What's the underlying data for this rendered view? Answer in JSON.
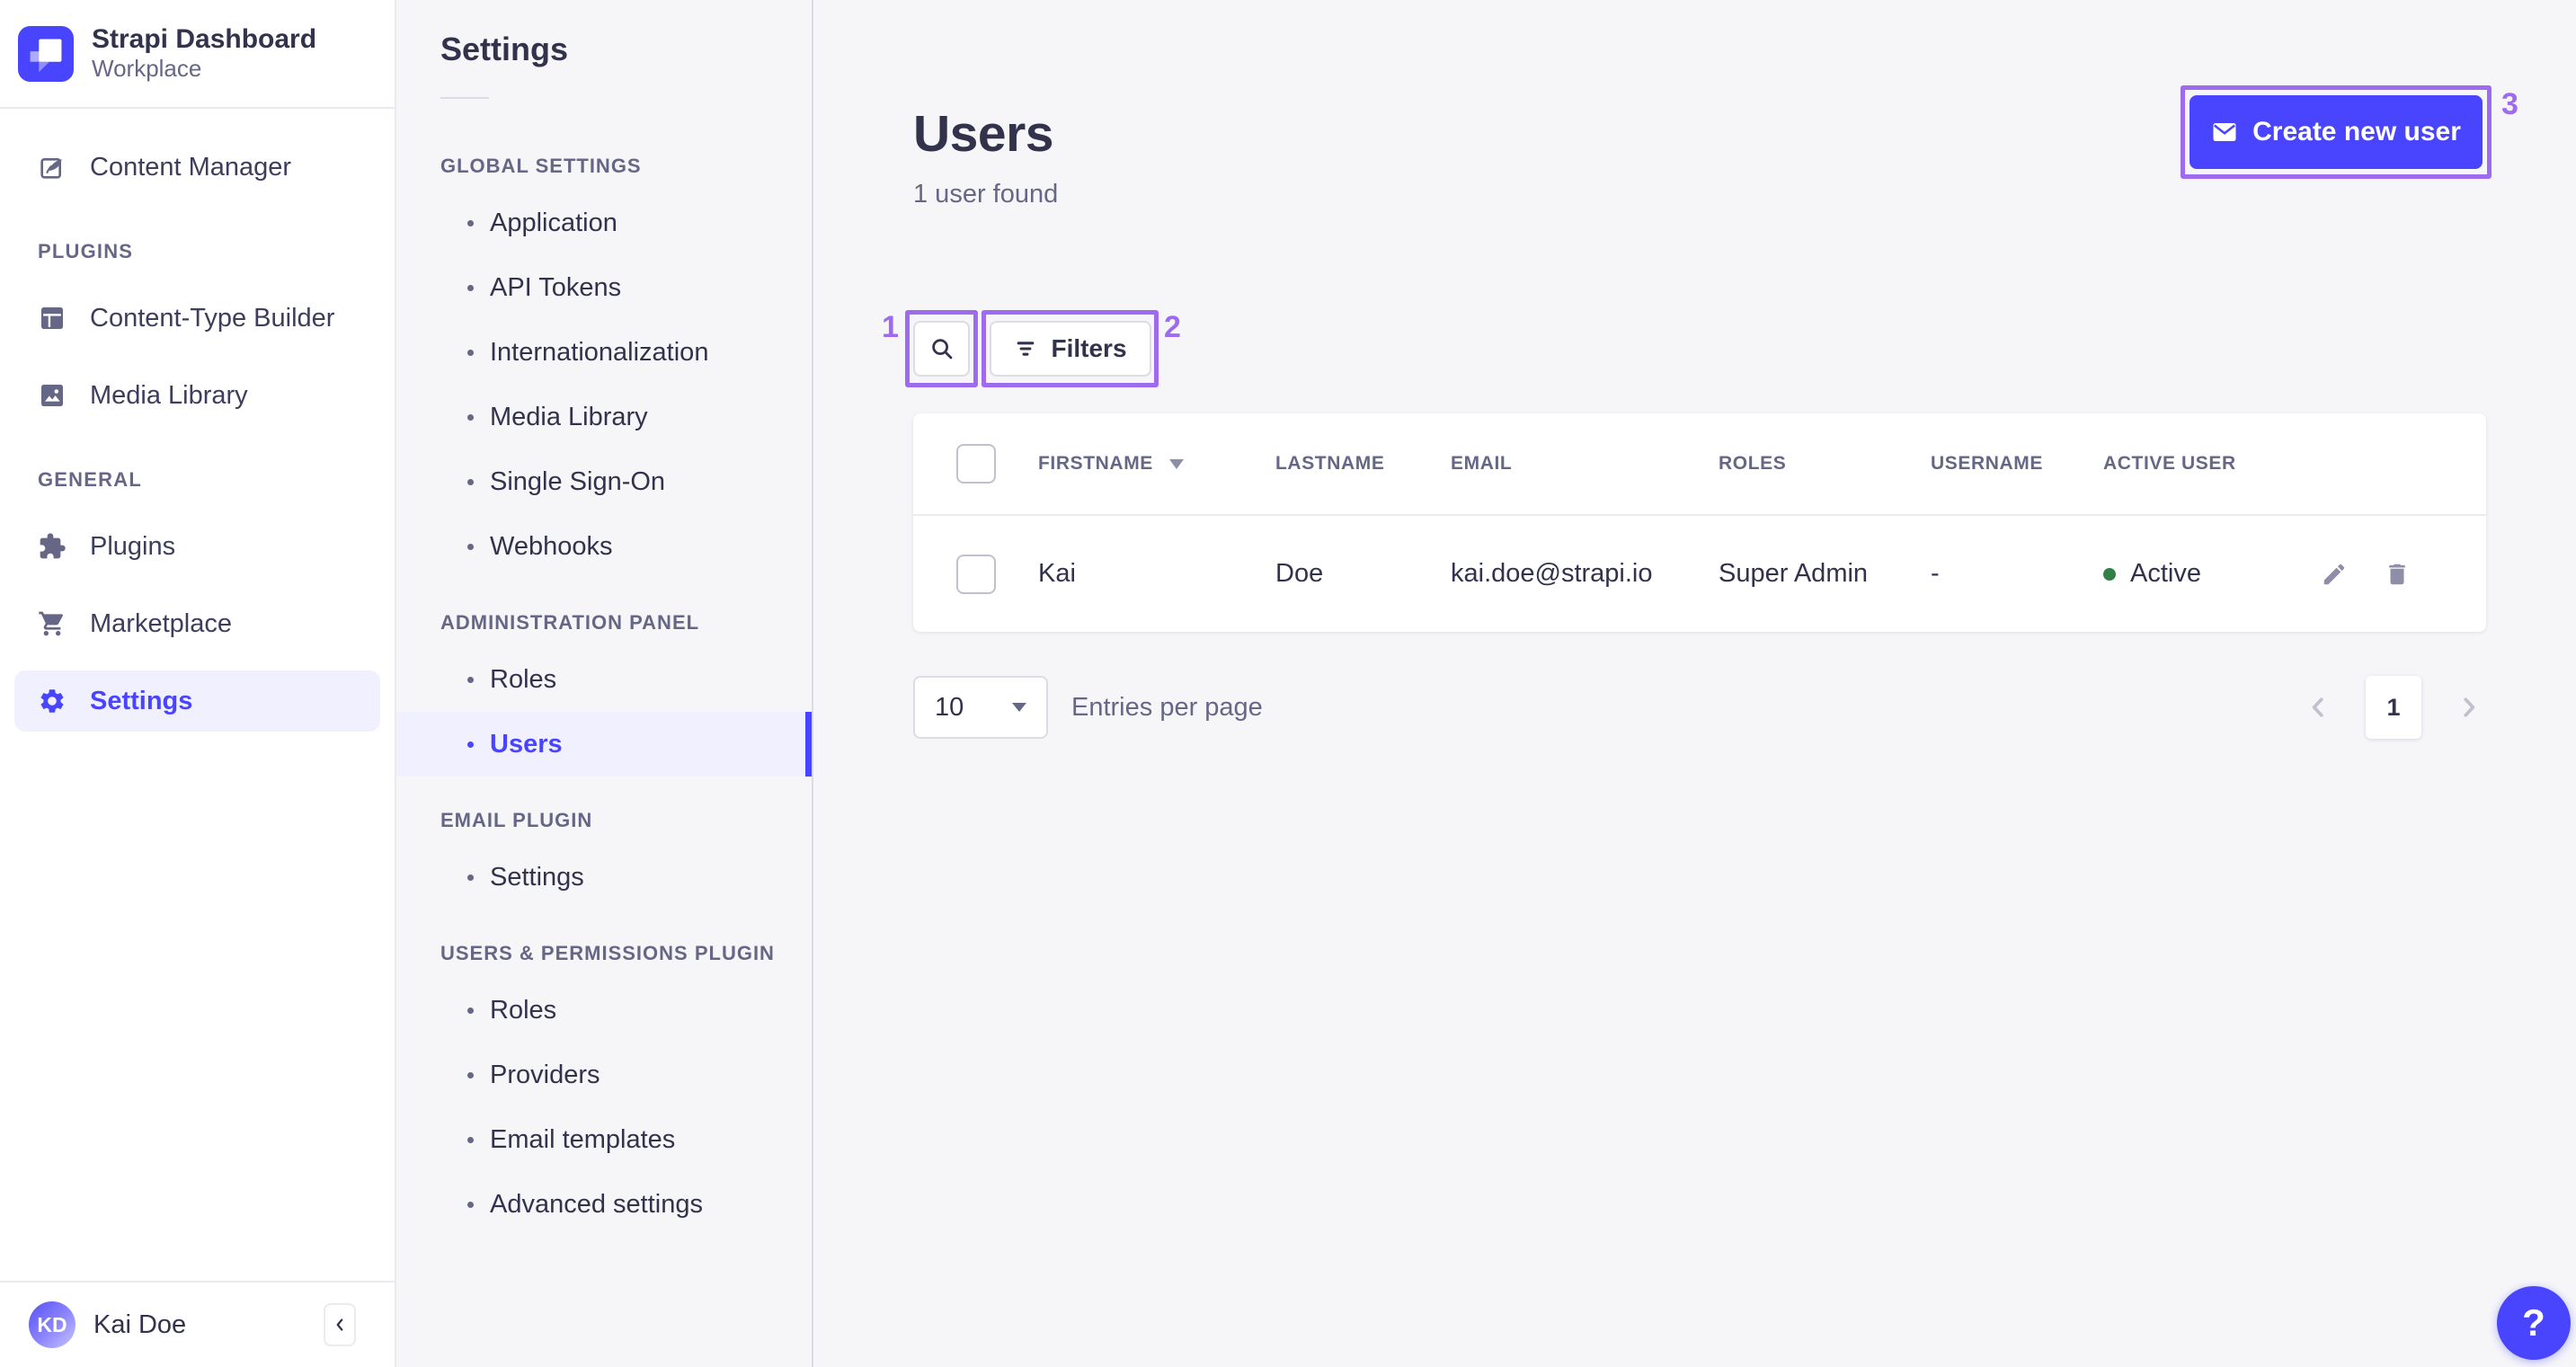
{
  "colors": {
    "primary": "#4945ff",
    "primary_light_bg": "#f0f0ff",
    "text_dark": "#32324d",
    "text_muted": "#666687",
    "border": "#eaeaef",
    "page_bg": "#f6f6f9",
    "annotation_purple": "#9e6bf0",
    "status_active_green": "#328048"
  },
  "sidebar": {
    "brand": {
      "title": "Strapi Dashboard",
      "subtitle": "Workplace",
      "logo_icon": "strapi-logo-icon"
    },
    "primary_item": {
      "label": "Content Manager",
      "icon": "feather-pen-icon"
    },
    "sections": [
      {
        "header": "PLUGINS",
        "items": [
          {
            "label": "Content-Type Builder",
            "icon": "layout-grid-icon"
          },
          {
            "label": "Media Library",
            "icon": "picture-icon"
          }
        ]
      },
      {
        "header": "GENERAL",
        "items": [
          {
            "label": "Plugins",
            "icon": "puzzle-icon"
          },
          {
            "label": "Marketplace",
            "icon": "cart-icon"
          },
          {
            "label": "Settings",
            "icon": "gear-icon",
            "active": true
          }
        ]
      }
    ],
    "user": {
      "initials": "KD",
      "name": "Kai Doe"
    }
  },
  "settings_nav": {
    "title": "Settings",
    "sections": [
      {
        "header": "GLOBAL SETTINGS",
        "items": [
          {
            "label": "Application"
          },
          {
            "label": "API Tokens"
          },
          {
            "label": "Internationalization"
          },
          {
            "label": "Media Library"
          },
          {
            "label": "Single Sign-On"
          },
          {
            "label": "Webhooks"
          }
        ]
      },
      {
        "header": "ADMINISTRATION PANEL",
        "items": [
          {
            "label": "Roles"
          },
          {
            "label": "Users",
            "active": true
          }
        ]
      },
      {
        "header": "EMAIL PLUGIN",
        "items": [
          {
            "label": "Settings"
          }
        ]
      },
      {
        "header": "USERS & PERMISSIONS PLUGIN",
        "items": [
          {
            "label": "Roles"
          },
          {
            "label": "Providers"
          },
          {
            "label": "Email templates"
          },
          {
            "label": "Advanced settings"
          }
        ]
      }
    ]
  },
  "page": {
    "title": "Users",
    "subtitle": "1 user found",
    "create_button_label": "Create new user",
    "filters_button_label": "Filters"
  },
  "table": {
    "columns": [
      "FIRSTNAME",
      "LASTNAME",
      "EMAIL",
      "ROLES",
      "USERNAME",
      "ACTIVE USER"
    ],
    "sorted_column": "FIRSTNAME",
    "rows": [
      {
        "firstname": "Kai",
        "lastname": "Doe",
        "email": "kai.doe@strapi.io",
        "roles": "Super Admin",
        "username": "-",
        "active_user": "Active"
      }
    ]
  },
  "pagination": {
    "page_size": "10",
    "entries_label": "Entries per page",
    "current_page": "1"
  },
  "annotations": [
    {
      "label": "1"
    },
    {
      "label": "2"
    },
    {
      "label": "3"
    }
  ],
  "help_label": "?"
}
